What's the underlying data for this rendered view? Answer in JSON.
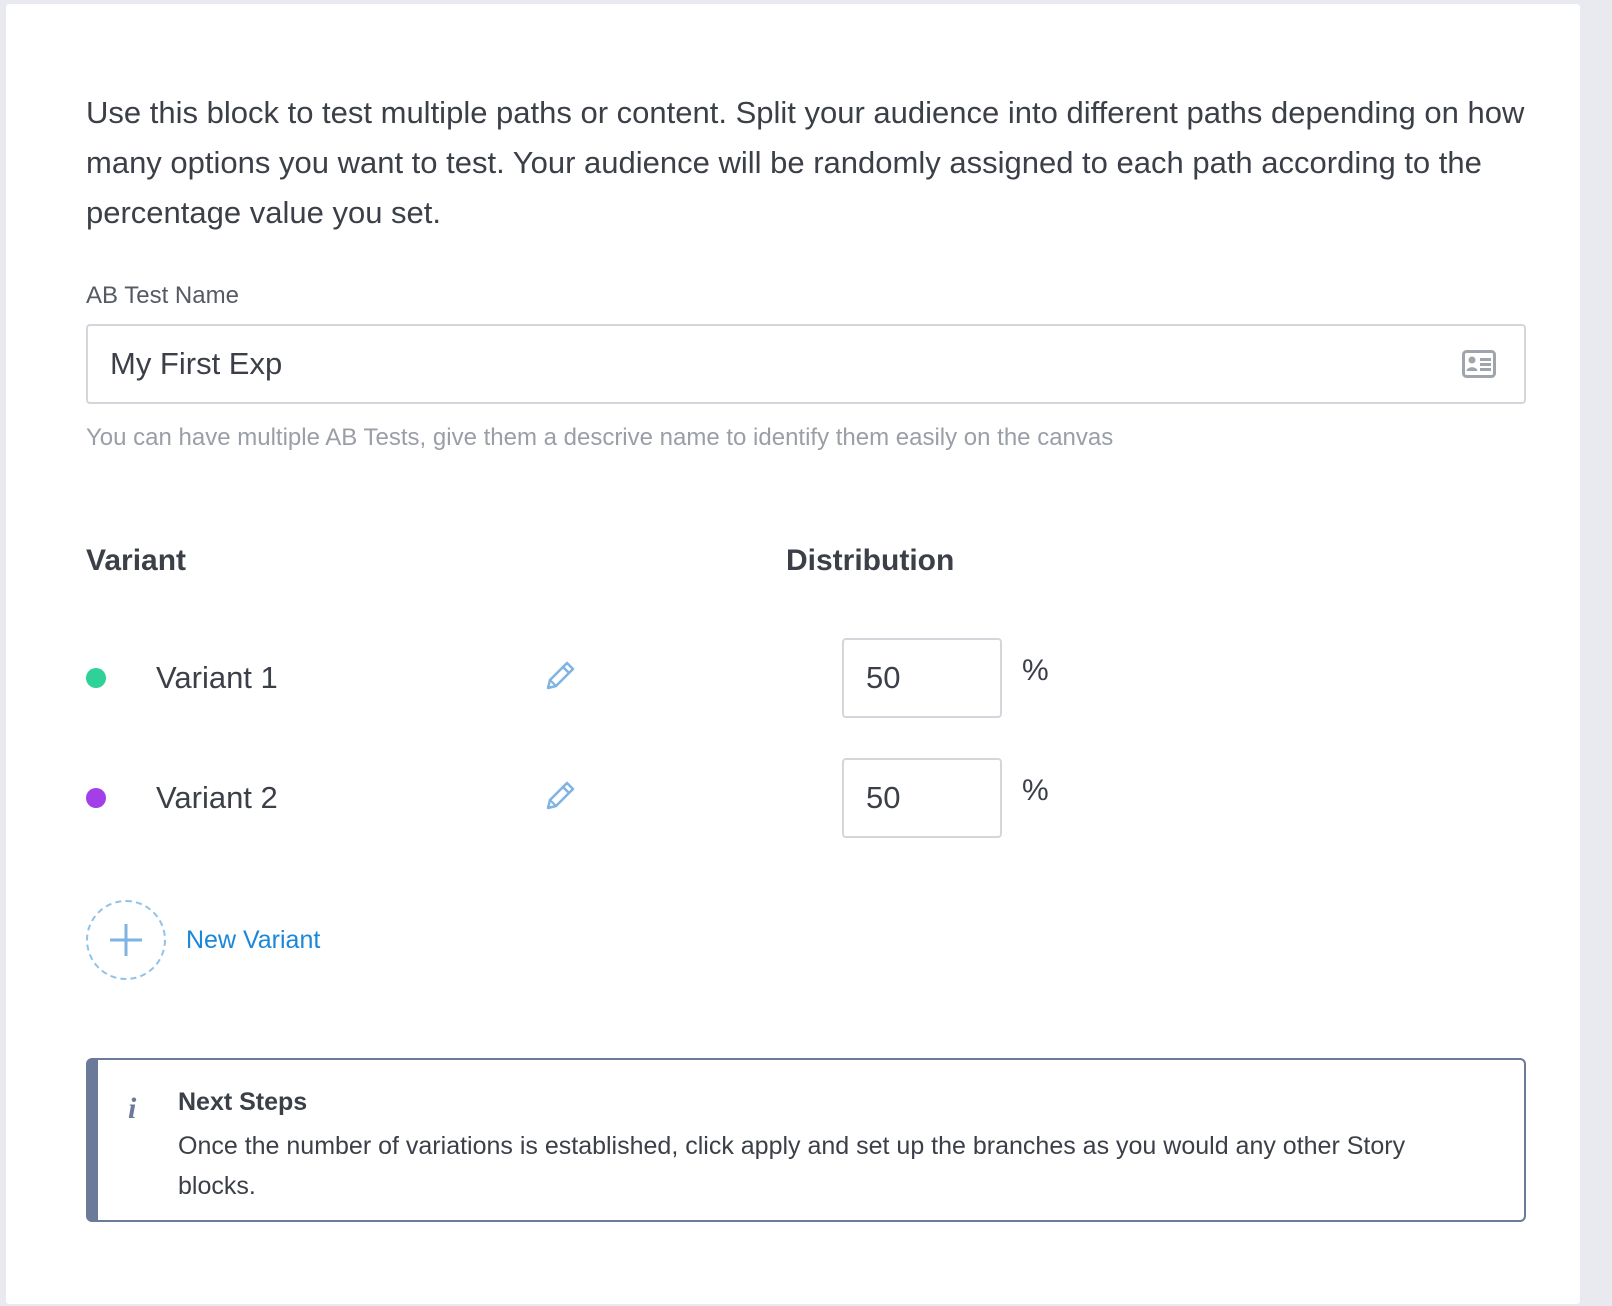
{
  "intro": {
    "text": "Use this block to test multiple paths or content. Split your audience into different paths depending on how many options you want to test. Your audience will be randomly assigned to each path according to the percentage value you set."
  },
  "name_field": {
    "label": "AB Test Name",
    "value": "My First Exp",
    "icon": "contact-card-icon",
    "hint": "You can have multiple AB Tests, give them a descrive name to identify them easily on the canvas"
  },
  "table": {
    "variant_header": "Variant",
    "distribution_header": "Distribution"
  },
  "variants": [
    {
      "name": "Variant 1",
      "color": "#2ed197",
      "distribution": "50",
      "unit": "%"
    },
    {
      "name": "Variant 2",
      "color": "#a23fe8",
      "distribution": "50",
      "unit": "%"
    }
  ],
  "new_variant": {
    "label": "New Variant"
  },
  "info": {
    "icon": "info-icon",
    "icon_glyph": "i",
    "title": "Next Steps",
    "text": "Once the number of variations is established, click apply and set up the branches as you would any other Story blocks."
  },
  "colors": {
    "accent_blue": "#1a87d8",
    "info_border": "#6b7a99"
  }
}
